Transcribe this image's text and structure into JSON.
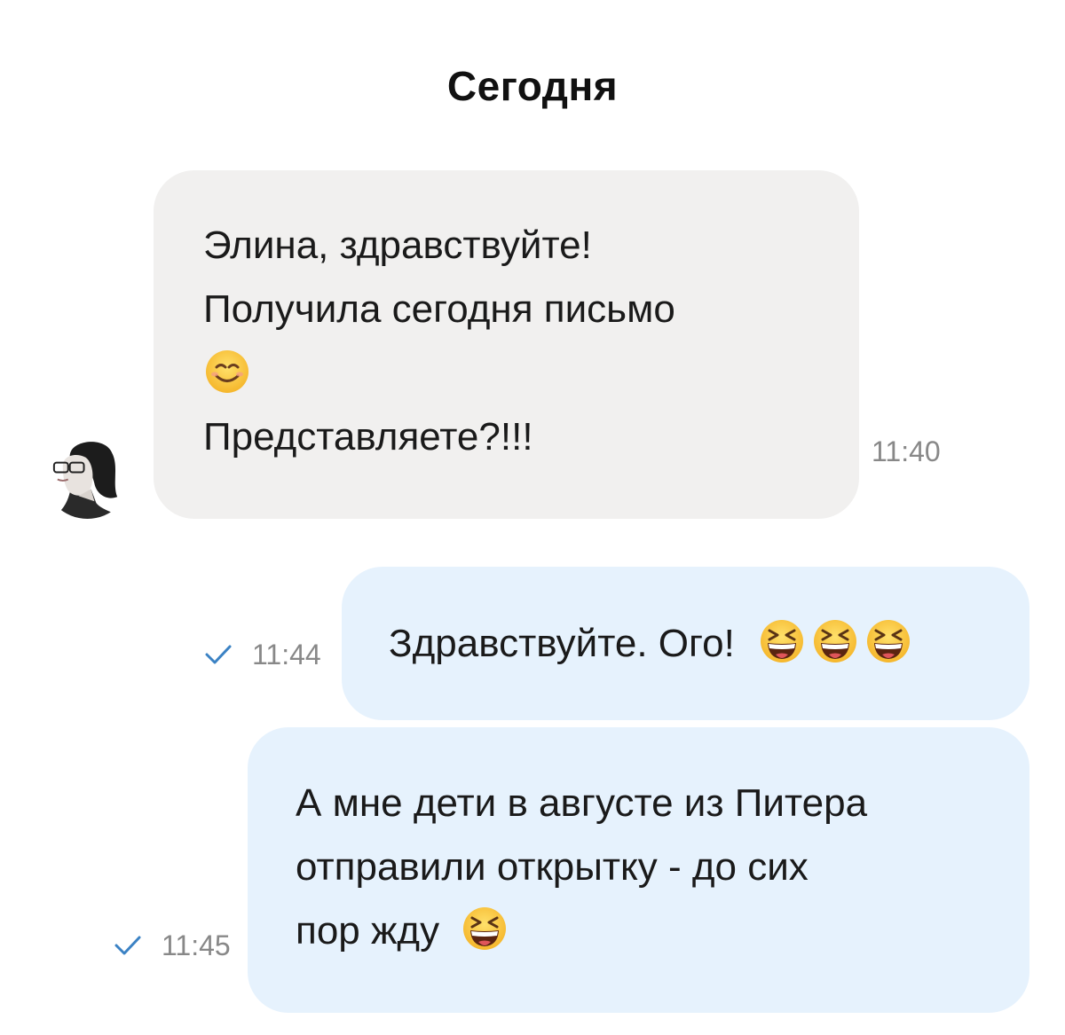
{
  "chat": {
    "date_label": "Сегодня",
    "messages": [
      {
        "direction": "incoming",
        "lines": [
          "Элина, здравствуйте!",
          "Получила сегодня письмо",
          "Представляете?!!!"
        ],
        "emoji": "smiling-face-with-smiling-eyes-emoji",
        "time": "11:40"
      },
      {
        "direction": "outgoing",
        "text": "Здравствуйте. Ого!",
        "emoji": "grinning-squinting-face-emoji",
        "emoji_count": 3,
        "time": "11:44",
        "status": "sent-check-icon"
      },
      {
        "direction": "outgoing",
        "lines": [
          "А мне дети в августе из Питера",
          "отправили открытку - до сих",
          "пор жду"
        ],
        "emoji": "grinning-squinting-face-emoji",
        "time": "11:45",
        "status": "sent-check-icon"
      }
    ]
  },
  "colors": {
    "incoming_bubble": "#f1f0ef",
    "outgoing_bubble": "#e6f2fd",
    "check": "#3b82c4",
    "timestamp": "#888888"
  }
}
